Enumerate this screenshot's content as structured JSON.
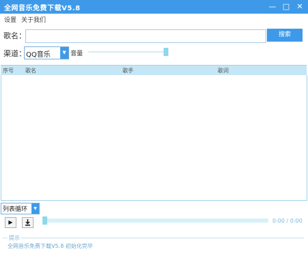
{
  "window": {
    "title": "全网音乐免费下载V5.8",
    "controls": {
      "minimize": "—",
      "maximize": "□",
      "close": "✕"
    }
  },
  "menu": {
    "settings": "设置",
    "about": "关于我们"
  },
  "search": {
    "label": "歌名：",
    "value": "",
    "placeholder": "",
    "button": "搜索"
  },
  "channel": {
    "label": "渠道：",
    "selected": "QQ音乐"
  },
  "volume": {
    "label": "音量",
    "level_percent": 98
  },
  "table": {
    "columns": [
      "序号",
      "歌名",
      "歌手",
      "歌词"
    ],
    "rows": []
  },
  "player": {
    "mode": "列表循环",
    "play_icon": "play-icon",
    "download_icon": "download-icon",
    "progress_percent": 0,
    "time": "0:00 / 0:00"
  },
  "hint": {
    "legend": "提示",
    "message": "全网音乐免费下载V5.8 初始化完毕"
  },
  "colors": {
    "accent": "#3e9ae8",
    "header_bg": "#c5e6f6",
    "slider": "#8fd8ec"
  }
}
